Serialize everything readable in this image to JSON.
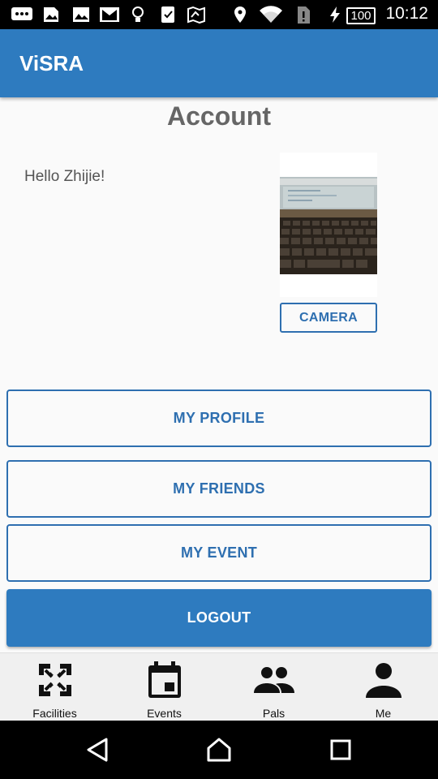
{
  "status_bar": {
    "time": "10:12",
    "battery": "100",
    "icons": [
      "chat-icon",
      "image-icon",
      "gallery-icon",
      "mail-icon",
      "bulb-icon",
      "checklist-icon",
      "map-icon",
      "location-icon",
      "wifi-icon",
      "sim-alert-icon",
      "charging-icon",
      "battery-icon"
    ]
  },
  "app_bar": {
    "title": "ViSRA"
  },
  "page": {
    "title": "Account",
    "greeting": "Hello Zhijie!",
    "camera_label": "CAMERA"
  },
  "buttons": {
    "my_profile": "MY PROFILE",
    "my_friends": "MY FRIENDS",
    "my_event": "MY EVENT",
    "logout": "LOGOUT"
  },
  "bottom_nav": [
    {
      "label": "Facilities",
      "icon": "facilities-icon"
    },
    {
      "label": "Events",
      "icon": "calendar-icon"
    },
    {
      "label": "Pals",
      "icon": "people-icon"
    },
    {
      "label": "Me",
      "icon": "person-icon"
    }
  ],
  "system_nav": {
    "icons": [
      "back-icon",
      "home-icon",
      "recents-icon"
    ]
  },
  "colors": {
    "primary": "#2e7bbf",
    "accent_text": "#2e6fb0",
    "background": "#fafafa"
  }
}
